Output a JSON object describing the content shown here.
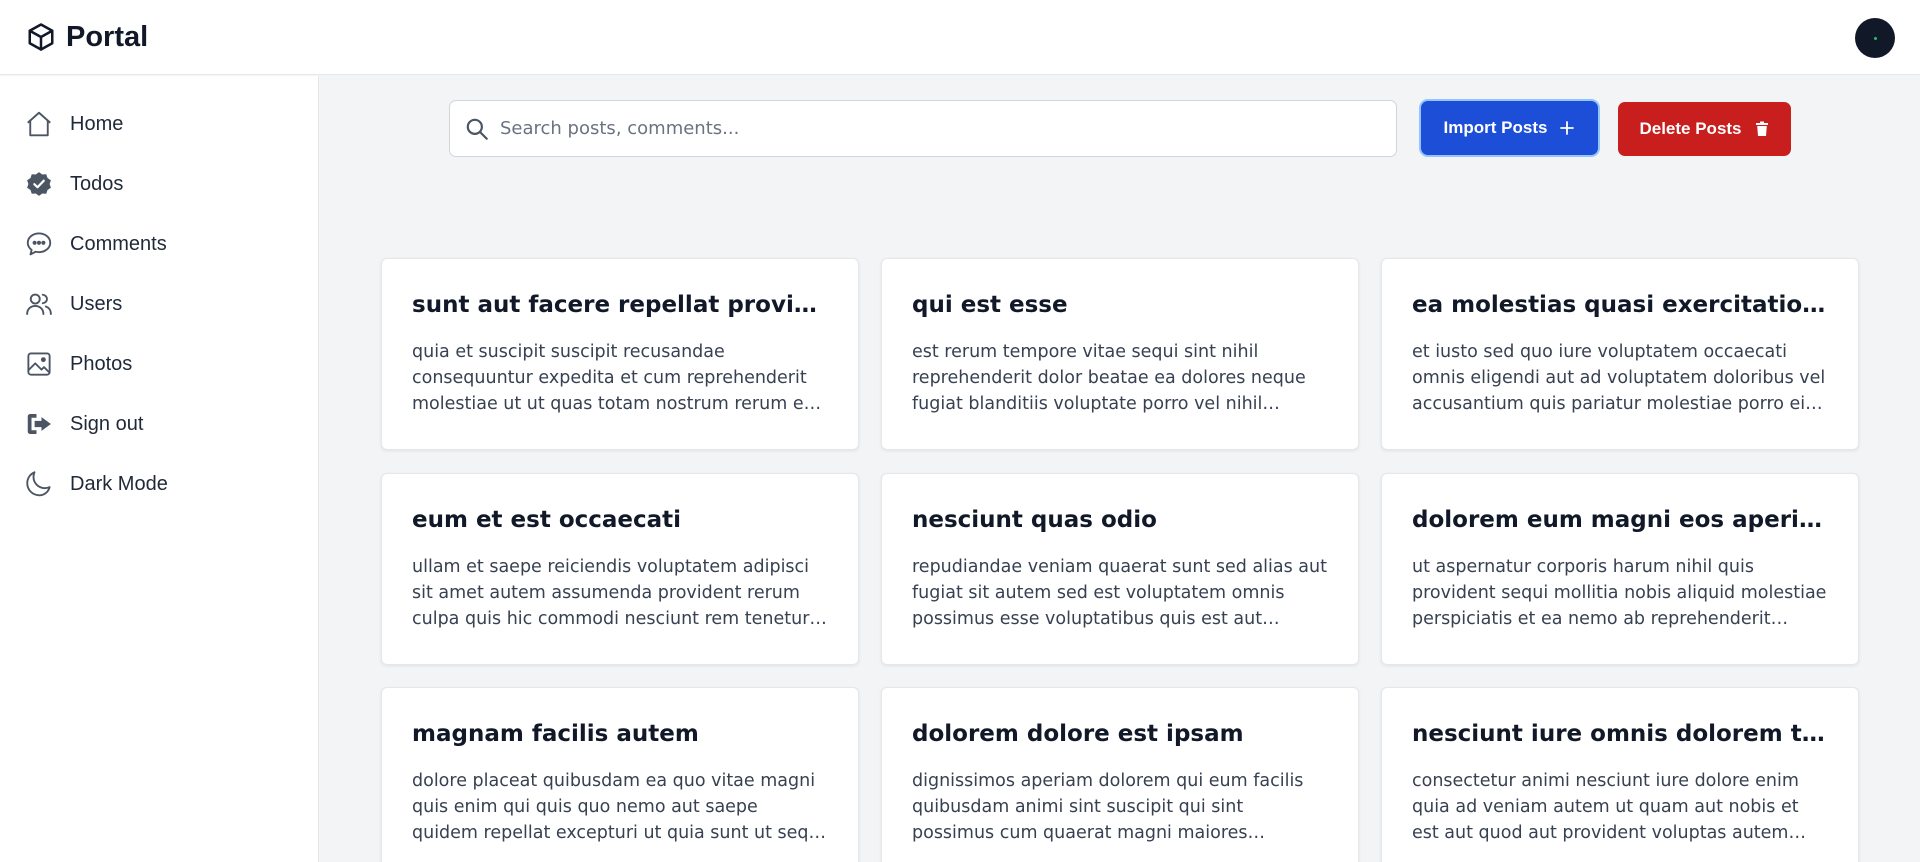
{
  "app": {
    "title": "Portal",
    "logo_icon": "cube-icon"
  },
  "header": {
    "avatar_icon": "user-avatar"
  },
  "sidebar": {
    "items": [
      {
        "label": "Home",
        "icon": "home-icon"
      },
      {
        "label": "Todos",
        "icon": "badge-check-icon"
      },
      {
        "label": "Comments",
        "icon": "chat-bubbles-icon"
      },
      {
        "label": "Users",
        "icon": "users-icon"
      },
      {
        "label": "Photos",
        "icon": "photo-icon"
      },
      {
        "label": "Sign out",
        "icon": "sign-out-icon"
      },
      {
        "label": "Dark Mode",
        "icon": "moon-icon"
      }
    ]
  },
  "search": {
    "placeholder": "Search posts, comments...",
    "value": ""
  },
  "actions": {
    "import_label": "Import Posts",
    "delete_label": "Delete Posts"
  },
  "colors": {
    "import": "#1d4ed8",
    "delete": "#c81e1e",
    "background": "#f3f4f6"
  },
  "posts": [
    {
      "title": "sunt aut facere repellat provident occaecati excepturi optio reprehenderit",
      "body": "quia et suscipit suscipit recusandae consequuntur expedita et cum reprehenderit molestiae ut ut quas totam nostrum rerum est autem sunt rem eveniet architecto"
    },
    {
      "title": "qui est esse",
      "body": "est rerum tempore vitae sequi sint nihil reprehenderit dolor beatae ea dolores neque fugiat blanditiis voluptate porro vel nihil molestiae ut reiciendis qui aperiam non debitis possimus qui neque nisi nulla"
    },
    {
      "title": "ea molestias quasi exercitationem repellat qui ipsa sit aut",
      "body": "et iusto sed quo iure voluptatem occaecati omnis eligendi aut ad voluptatem doloribus vel accusantium quis pariatur molestiae porro eius odio et labore et velit aut"
    },
    {
      "title": "eum et est occaecati",
      "body": "ullam et saepe reiciendis voluptatem adipisci sit amet autem assumenda provident rerum culpa quis hic commodi nesciunt rem tenetur doloremque ipsam iure quis sunt voluptatem rerum illo velit"
    },
    {
      "title": "nesciunt quas odio",
      "body": "repudiandae veniam quaerat sunt sed alias aut fugiat sit autem sed est voluptatem omnis possimus esse voluptatibus quis est aut tenetur dolor neque"
    },
    {
      "title": "dolorem eum magni eos aperiam quia",
      "body": "ut aspernatur corporis harum nihil quis provident sequi mollitia nobis aliquid molestiae perspiciatis et ea nemo ab reprehenderit accusantium quas voluptate dolores velit et doloremque molestiae"
    },
    {
      "title": "magnam facilis autem",
      "body": "dolore placeat quibusdam ea quo vitae magni quis enim qui quis quo nemo aut saepe quidem repellat excepturi ut quia sunt ut sequi eos ea sed quas"
    },
    {
      "title": "dolorem dolore est ipsam",
      "body": "dignissimos aperiam dolorem qui eum facilis quibusdam animi sint suscipit qui sint possimus cum quaerat magni maiores excepturi ipsam ut commodi dolor voluptatum modi aut vitae"
    },
    {
      "title": "nesciunt iure omnis dolorem tempora et accusantium",
      "body": "consectetur animi nesciunt iure dolore enim quia ad veniam autem ut quam aut nobis et est aut quod aut provident voluptas autem voluptas"
    }
  ]
}
